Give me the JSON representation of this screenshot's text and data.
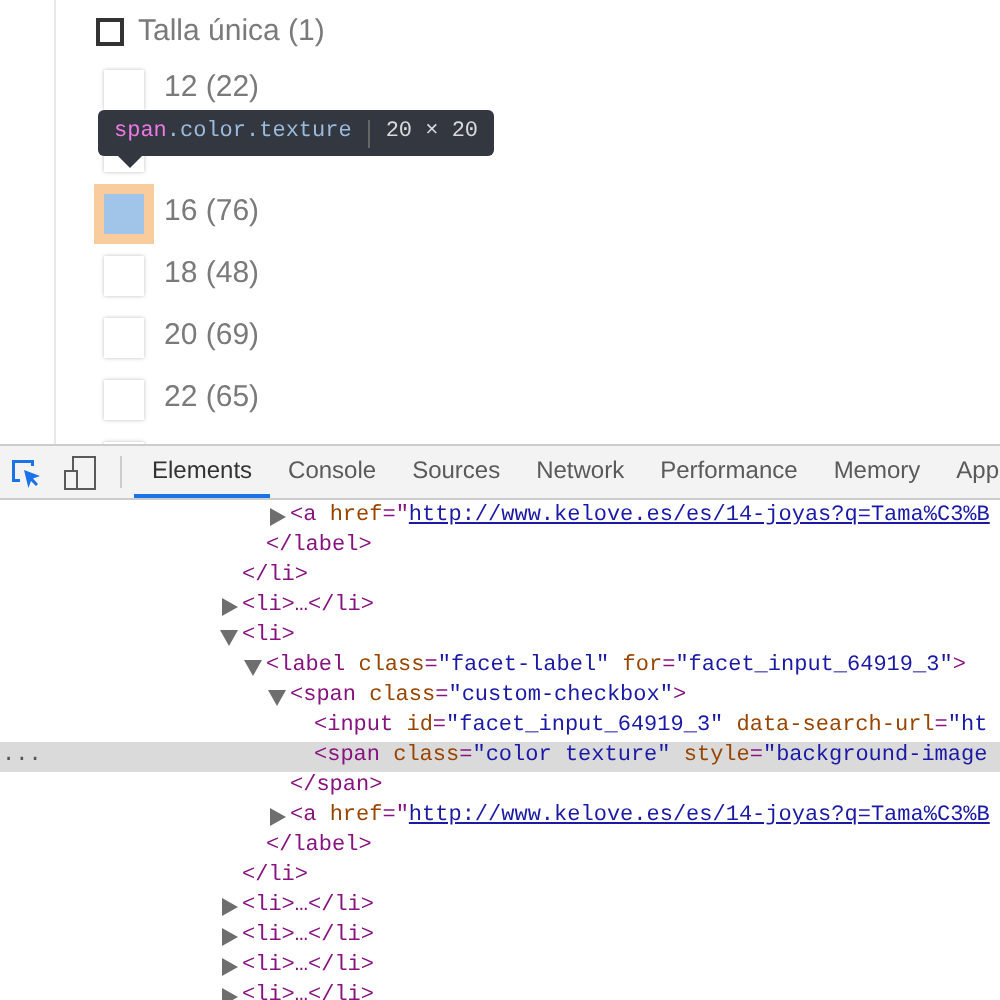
{
  "facets": {
    "group": {
      "label": "Talla única (1)",
      "checked": false
    },
    "options": [
      {
        "label": "12 (22)",
        "inspected": false
      },
      {
        "inspected": false
      },
      {
        "label": "16 (76)",
        "inspected": true
      },
      {
        "label": "18 (48)",
        "inspected": false
      },
      {
        "label": "20 (69)",
        "inspected": false
      },
      {
        "label": "22 (65)",
        "inspected": false
      },
      {
        "inspected": false
      }
    ]
  },
  "tooltip": {
    "tag": "span",
    "classes": ".color.texture",
    "size": "20 × 20"
  },
  "devtools": {
    "tabs": [
      {
        "label": "Elements",
        "selected": true
      },
      {
        "label": "Console",
        "selected": false
      },
      {
        "label": "Sources",
        "selected": false
      },
      {
        "label": "Network",
        "selected": false
      },
      {
        "label": "Performance",
        "selected": false
      },
      {
        "label": "Memory",
        "selected": false
      },
      {
        "label": "App",
        "selected": false
      }
    ],
    "dom": [
      {
        "children": [
          {
            "children": [
              {
                "expanded": false,
                "tokens": [
                  {
                    "kind": "tag",
                    "text": "<a "
                  },
                  {
                    "kind": "attr",
                    "text": "href"
                  },
                  {
                    "kind": "tag",
                    "text": "=\""
                  },
                  {
                    "kind": "link",
                    "text": "http://www.kelove.es/es/14-joyas?q=Tama%C3%B"
                  }
                ]
              }
            ],
            "close": "</label>"
          }
        ],
        "close": "</li>"
      },
      {
        "expanded": false,
        "tokens": [
          {
            "kind": "tag",
            "text": "<li>…</li>"
          }
        ]
      },
      {
        "expanded": true,
        "tokens": [
          {
            "kind": "tag",
            "text": "<li>"
          }
        ],
        "close": "</li>",
        "children": [
          {
            "expanded": true,
            "tokens": [
              {
                "kind": "tag",
                "text": "<label "
              },
              {
                "kind": "attr",
                "text": "class"
              },
              {
                "kind": "tag",
                "text": "="
              },
              {
                "kind": "value",
                "text": "\"facet-label\""
              },
              {
                "kind": "attr",
                "text": " for"
              },
              {
                "kind": "tag",
                "text": "="
              },
              {
                "kind": "value",
                "text": "\"facet_input_64919_3\""
              },
              {
                "kind": "tag",
                "text": ">"
              }
            ],
            "close": "</label>",
            "children": [
              {
                "expanded": true,
                "tokens": [
                  {
                    "kind": "tag",
                    "text": "<span "
                  },
                  {
                    "kind": "attr",
                    "text": "class"
                  },
                  {
                    "kind": "tag",
                    "text": "="
                  },
                  {
                    "kind": "value",
                    "text": "\"custom-checkbox\""
                  },
                  {
                    "kind": "tag",
                    "text": ">"
                  }
                ],
                "close": "</span>",
                "children": [
                  {
                    "tokens": [
                      {
                        "kind": "tag",
                        "text": "<input "
                      },
                      {
                        "kind": "attr",
                        "text": "id"
                      },
                      {
                        "kind": "tag",
                        "text": "="
                      },
                      {
                        "kind": "value",
                        "text": "\"facet_input_64919_3\""
                      },
                      {
                        "kind": "attr",
                        "text": " data-search-url"
                      },
                      {
                        "kind": "tag",
                        "text": "="
                      },
                      {
                        "kind": "value",
                        "text": "\"ht"
                      }
                    ]
                  },
                  {
                    "selected": true,
                    "gutter": "...",
                    "tokens": [
                      {
                        "kind": "tag",
                        "text": "<span "
                      },
                      {
                        "kind": "attr",
                        "text": "class"
                      },
                      {
                        "kind": "tag",
                        "text": "="
                      },
                      {
                        "kind": "value",
                        "text": "\"color texture\""
                      },
                      {
                        "kind": "attr",
                        "text": " style"
                      },
                      {
                        "kind": "tag",
                        "text": "="
                      },
                      {
                        "kind": "value",
                        "text": "\"background-image"
                      }
                    ]
                  }
                ]
              },
              {
                "expanded": false,
                "tokens": [
                  {
                    "kind": "tag",
                    "text": "<a "
                  },
                  {
                    "kind": "attr",
                    "text": "href"
                  },
                  {
                    "kind": "tag",
                    "text": "=\""
                  },
                  {
                    "kind": "link",
                    "text": "http://www.kelove.es/es/14-joyas?q=Tama%C3%B"
                  }
                ]
              }
            ]
          }
        ]
      },
      {
        "expanded": false,
        "tokens": [
          {
            "kind": "tag",
            "text": "<li>…</li>"
          }
        ]
      },
      {
        "expanded": false,
        "tokens": [
          {
            "kind": "tag",
            "text": "<li>…</li>"
          }
        ]
      },
      {
        "expanded": false,
        "tokens": [
          {
            "kind": "tag",
            "text": "<li>…</li>"
          }
        ]
      },
      {
        "expanded": false,
        "tokens": [
          {
            "kind": "tag",
            "text": "<li>…</li>"
          }
        ]
      }
    ]
  }
}
